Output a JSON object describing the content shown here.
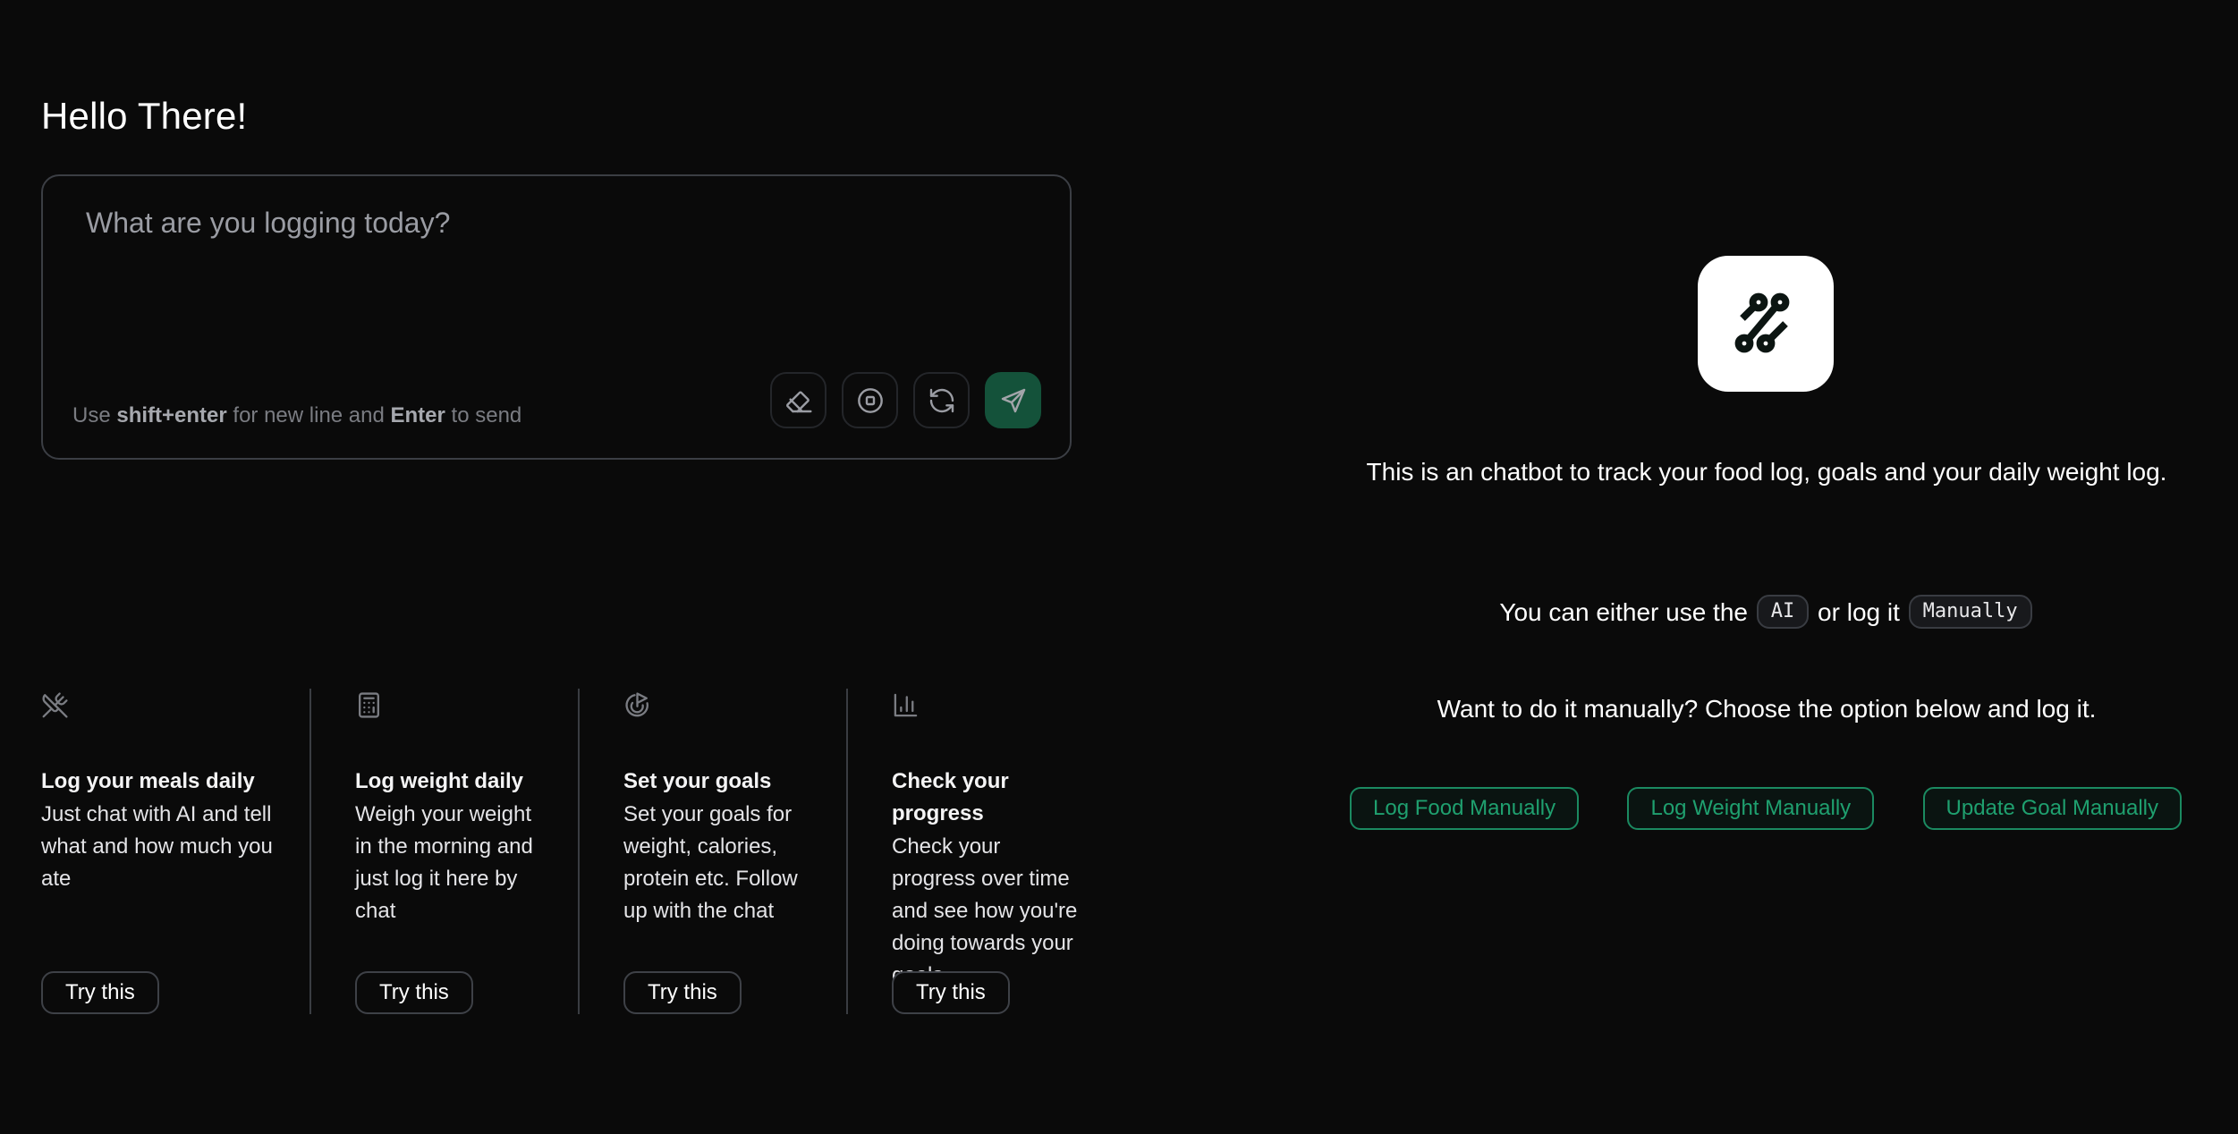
{
  "greeting": "Hello There!",
  "composer": {
    "placeholder": "What are you logging today?",
    "value": "",
    "hint": {
      "prefix": "Use ",
      "key1": "shift+enter",
      "middle": " for new line and ",
      "key2": "Enter",
      "suffix": " to send"
    },
    "actions": [
      {
        "name": "clear",
        "icon": "eraser-icon"
      },
      {
        "name": "stop",
        "icon": "stop-icon"
      },
      {
        "name": "regenerate",
        "icon": "refresh-icon"
      },
      {
        "name": "send",
        "icon": "send-icon"
      }
    ]
  },
  "features": [
    {
      "icon": "utensils-crossed-icon",
      "title": "Log your meals daily",
      "description": "Just chat with AI and tell what and how much you ate",
      "button": "Try this"
    },
    {
      "icon": "calculator-icon",
      "title": "Log weight daily",
      "description": "Weigh your weight in the morning and just log it here by chat",
      "button": "Try this"
    },
    {
      "icon": "goal-icon",
      "title": "Set your goals",
      "description": "Set your goals for weight, calories, protein etc. Follow up with the chat",
      "button": "Try this"
    },
    {
      "icon": "bar-chart-icon",
      "title": "Check your progress",
      "description": "Check your progress over time and see how you're doing towards your goals",
      "button": "Try this"
    }
  ],
  "info": {
    "logo_icon": "circuit-logo-icon",
    "intro": "This is an chatbot to track your food log, goals and your daily weight log.",
    "either_prefix": "You can either use the",
    "pill_ai": "AI",
    "either_middle": "or log it",
    "pill_manual": "Manually",
    "want": "Want to do it manually? Choose the option below and log it.",
    "buttons": {
      "food": "Log Food Manually",
      "weight": "Log Weight Manually",
      "goal": "Update Goal Manually"
    }
  },
  "colors": {
    "background": "#0a0a0a",
    "accent": "#1fa06f",
    "send_button": "#14523a"
  }
}
